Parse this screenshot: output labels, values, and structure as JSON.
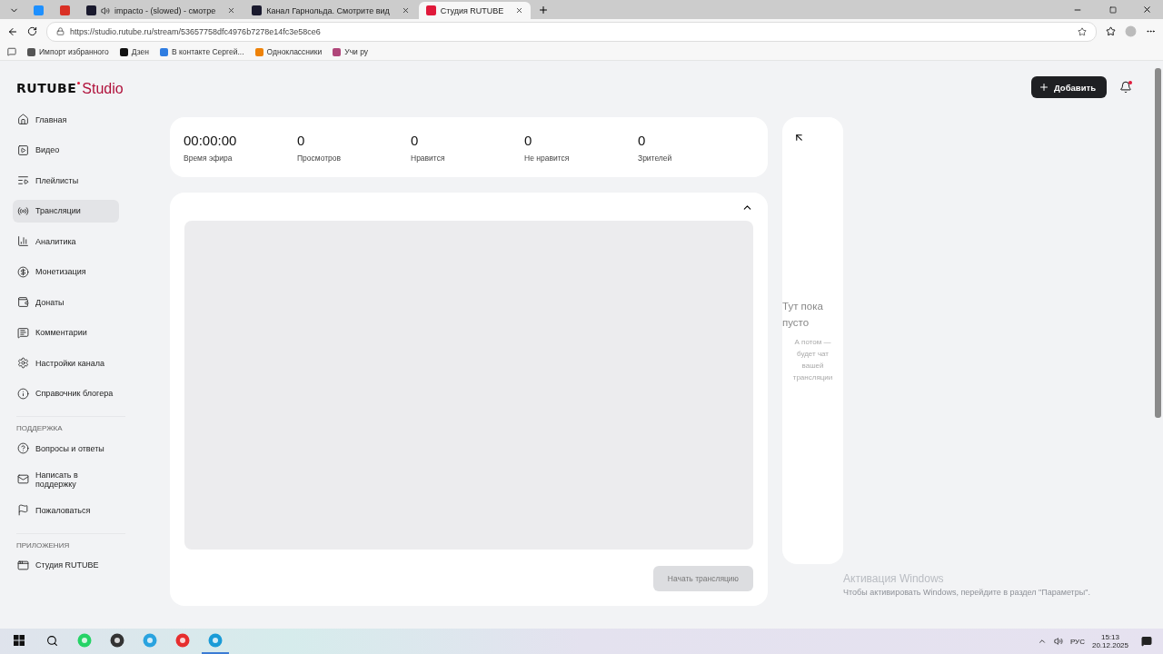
{
  "browser": {
    "tabs": [
      {
        "color": "#1e90ff",
        "audio": false,
        "selected": false
      },
      {
        "color": "#d93025",
        "audio": false,
        "selected": false
      },
      {
        "title": "impacto - (slowed) - смотре",
        "color": "#1a1a2e",
        "audio": true,
        "selected": false
      },
      {
        "title": "Канал Гарнольда. Смотрите вид",
        "color": "#1a1a2e",
        "audio": false,
        "selected": false
      },
      {
        "title": "Студия RUTUBE",
        "color": "#e0193a",
        "audio": false,
        "selected": true
      }
    ],
    "url": "https://studio.rutube.ru/stream/53657758dfc4976b7278e14fc3e58ce6",
    "bookmarks": [
      {
        "label": "Импорт избранного",
        "color": "#555555"
      },
      {
        "label": "Дзен",
        "color": "#111111"
      },
      {
        "label": "В контакте Сергей...",
        "color": "#2f7de1"
      },
      {
        "label": "Одноклассники",
        "color": "#ee8208"
      },
      {
        "label": "Учи ру",
        "color": "#b0467a"
      }
    ]
  },
  "logo": {
    "brand": "RUTUBE",
    "product": "Studio"
  },
  "header": {
    "add_button": "Добавить",
    "notifications_unread": true
  },
  "sidebar": {
    "items": [
      {
        "label": "Главная",
        "selected": false
      },
      {
        "label": "Видео",
        "selected": false
      },
      {
        "label": "Плейлисты",
        "selected": false
      },
      {
        "label": "Трансляции",
        "selected": true
      },
      {
        "label": "Аналитика",
        "selected": false
      },
      {
        "label": "Монетизация",
        "selected": false
      },
      {
        "label": "Донаты",
        "selected": false
      },
      {
        "label": "Комментарии",
        "selected": false
      },
      {
        "label": "Настройки канала",
        "selected": false
      },
      {
        "label": "Справочник блогера",
        "selected": false
      }
    ],
    "sections": [
      {
        "title": "ПОДДЕРЖКА",
        "items": [
          {
            "label": "Вопросы и ответы",
            "selected": false
          },
          {
            "label": "Написать в поддержку",
            "selected": false
          },
          {
            "label": "Пожаловаться",
            "selected": false
          }
        ]
      },
      {
        "title": "ПРИЛОЖЕНИЯ",
        "items": [
          {
            "label": "Студия RUTUBE",
            "selected": false
          }
        ]
      }
    ]
  },
  "stats": [
    {
      "value": "00:00:00",
      "label": "Время эфира"
    },
    {
      "value": "0",
      "label": "Просмотров"
    },
    {
      "value": "0",
      "label": "Нравится"
    },
    {
      "value": "0",
      "label": "Не нравится"
    },
    {
      "value": "0",
      "label": "Зрителей"
    }
  ],
  "player": {
    "expanded": true,
    "start_button": {
      "label": "Начать трансляцию",
      "disabled": true
    }
  },
  "chat": {
    "title": "Тут пока пусто",
    "subtitle": "А потом — будет чат вашей трансляции"
  },
  "activation": {
    "title": "Активация Windows",
    "text": "Чтобы активировать Windows, перейдите в раздел \"Параметры\"."
  },
  "taskbar": {
    "apps": [
      {
        "kind": "whatsapp",
        "selected": false
      },
      {
        "kind": "game",
        "selected": false
      },
      {
        "kind": "telegram",
        "selected": false
      },
      {
        "kind": "yandex",
        "selected": false
      },
      {
        "kind": "edge",
        "selected": true
      }
    ],
    "language": "РУС",
    "time": "15:13",
    "date": "20.12.2025"
  }
}
